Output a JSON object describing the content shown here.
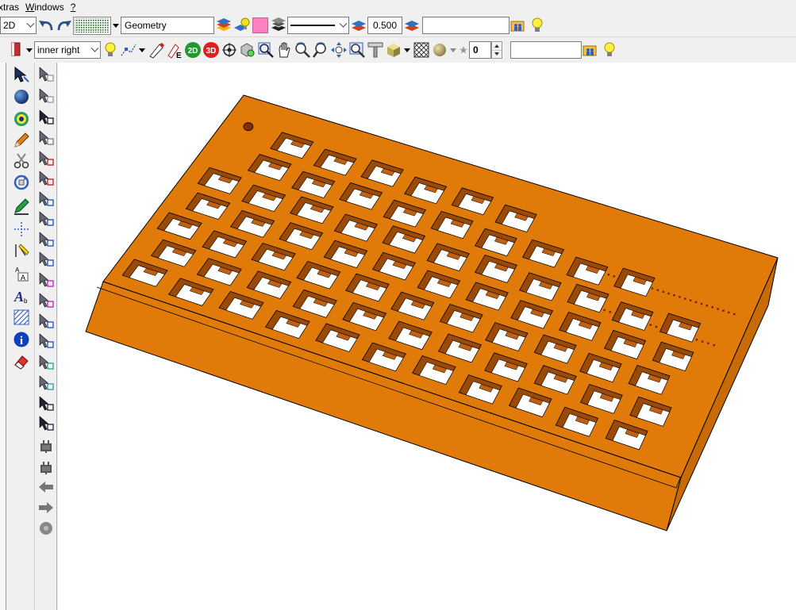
{
  "menu": [
    {
      "label": "xtras",
      "underline_index": 0
    },
    {
      "label": "Windows",
      "underline_index": 0
    },
    {
      "label": "?",
      "underline_index": 0
    }
  ],
  "toolbar1": {
    "view_mode": "2D",
    "layer_name": "Geometry",
    "line_width": "0.500",
    "layer_color": "#ff80c0",
    "extra_field": ""
  },
  "toolbar2": {
    "alignment": "inner right",
    "btn_2d": "2D",
    "btn_3d": "3D",
    "spin_value": "0",
    "extra_field": ""
  },
  "icons": {
    "toolbar1": [
      "undo-icon",
      "redo-icon",
      "grid-icon",
      "layer-manager-icon",
      "layer-visibility-icon",
      "pen-color-icon",
      "layer-stack-icon",
      "linetype-icon",
      "line-width-icon",
      "layer-stack-icon-2",
      "folder-users-icon",
      "lightbulb-icon"
    ],
    "toolbar2": [
      "pen-icon",
      "lightbulb-icon",
      "polyline-icon",
      "edit-pen-icon",
      "eraser-e-icon",
      "view-2d-icon",
      "view-3d-icon",
      "orbit-icon",
      "cube-zoom-icon",
      "magnifier-icon",
      "pan-hand-icon",
      "zoom-in-icon",
      "zoom-out-icon",
      "zoom-all-icon",
      "zoom-window-icon",
      "ruler-icon",
      "cube-icon",
      "hatch-icon",
      "sphere-icon",
      "star-icon",
      "folder-users-icon-2",
      "lightbulb-icon-2"
    ],
    "palette1": [
      "select-arrow-icon",
      "globe-icon",
      "palette-color-icon",
      "pencil-icon",
      "scissors-icon",
      "rotate-icon",
      "green-pen-icon",
      "dotted-axis-icon",
      "text-cursor-icon",
      "text-format-icon",
      "text-style-icon",
      "hatch-pattern-icon",
      "info-icon",
      "eraser-icon"
    ],
    "palette2": [
      "select-ghost-icon",
      "select-plus-icon",
      "select-dark-icon",
      "select-light-icon",
      "select-red-box-icon",
      "select-red-box-icon-2",
      "select-doc-icon",
      "select-doc-icon-2",
      "select-layer-icon",
      "select-layer-icon-2",
      "select-color-icon",
      "select-color-icon-2",
      "select-blue-icon",
      "select-blue-icon-2",
      "select-a-icon",
      "select-a-icon-2",
      "select-list-icon",
      "select-list-icon-2",
      "plug-icon",
      "plug-icon-2",
      "arrow-left-icon",
      "arrow-right-icon",
      "gear-gray-icon"
    ]
  },
  "model": {
    "plate_color": "#e07b0a",
    "side_color": "#c86a05",
    "edge_color": "#000000",
    "hole_color": "#ffffff",
    "rows": [
      6,
      9,
      11,
      11,
      11,
      12,
      12
    ]
  }
}
